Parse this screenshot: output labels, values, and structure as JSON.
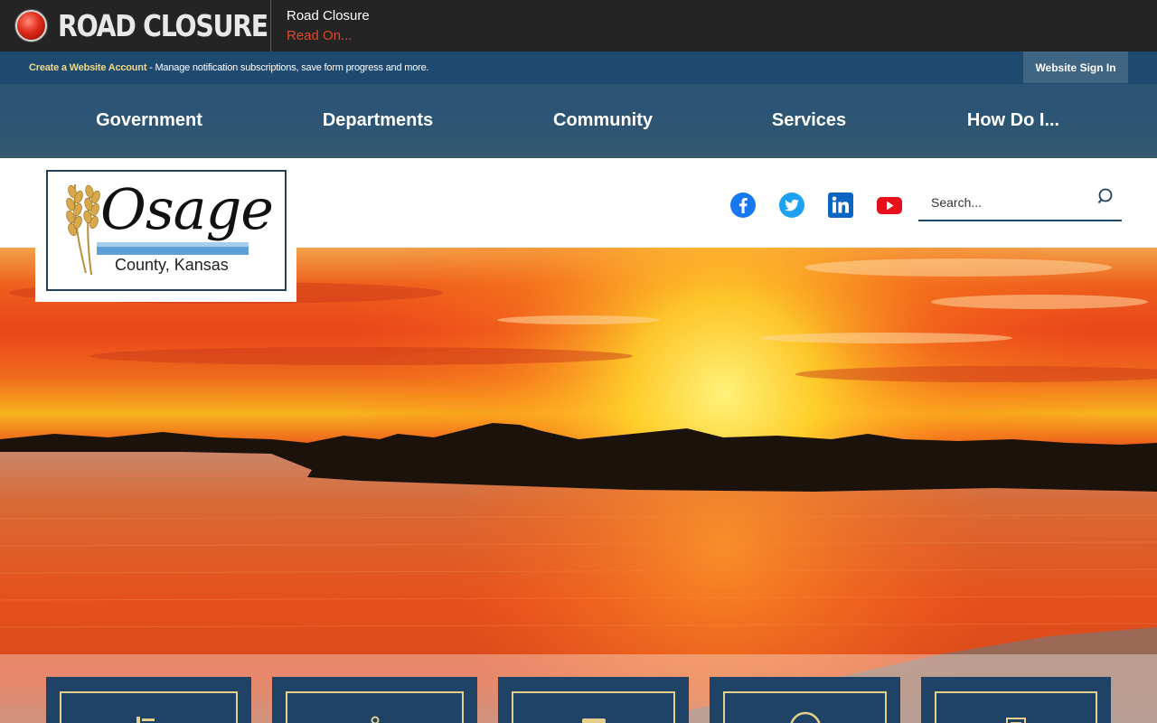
{
  "alert": {
    "title": "ROAD CLOSURE",
    "headline": "Road Closure",
    "link_label": "Read On..."
  },
  "account_bar": {
    "create_account_link": "Create a Website Account",
    "message": " - Manage notification subscriptions, save form progress and more.",
    "signin_label": "Website Sign In"
  },
  "nav": {
    "items": [
      {
        "label": "Government"
      },
      {
        "label": "Departments"
      },
      {
        "label": "Community"
      },
      {
        "label": "Services"
      },
      {
        "label": "How Do I..."
      }
    ]
  },
  "logo": {
    "name": "Osage",
    "tagline": "County, Kansas"
  },
  "social": {
    "icons": [
      "facebook-icon",
      "twitter-icon",
      "linkedin-icon",
      "youtube-icon"
    ]
  },
  "search": {
    "placeholder": "Search..."
  },
  "colors": {
    "alert_bg": "#242424",
    "alert_link": "#e4482b",
    "account_bar": "#1f4a6f",
    "account_link": "#f0d88a",
    "nav_bg": "#2d5574",
    "tile_bg": "#1f4366",
    "tile_border": "#e6cf8a"
  }
}
